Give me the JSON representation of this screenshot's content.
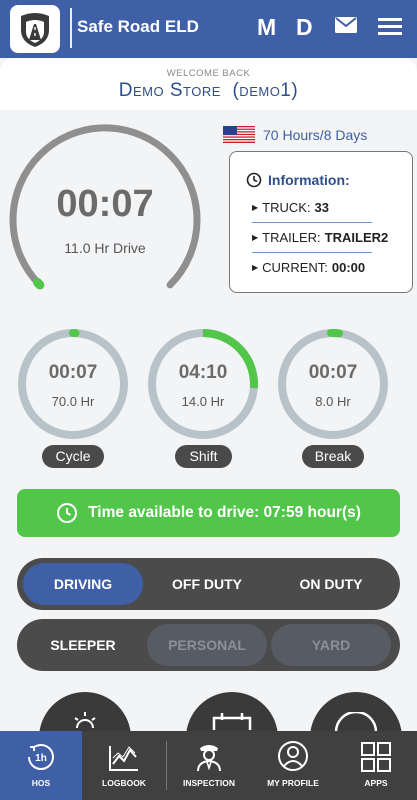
{
  "header": {
    "app_title": "Safe Road ELD",
    "btn_m": "M",
    "btn_d": "D",
    "icons": [
      "shield-road-logo",
      "mail-icon",
      "hamburger-menu-icon"
    ]
  },
  "welcome": {
    "small": "WELCOME BACK",
    "name": "Demo Store  (demo1)"
  },
  "rule": {
    "label": "70 Hours/8 Days"
  },
  "main_gauge": {
    "time": "00:07",
    "label": "11.0 Hr Drive",
    "progress": 0.01
  },
  "info": {
    "title": "Information:",
    "truck_label": "TRUCK:",
    "truck_value": "33",
    "trailer_label": "TRAILER:",
    "trailer_value": "TRAILER2",
    "current_label": "CURRENT:",
    "current_value": "00:00"
  },
  "gauges": [
    {
      "time": "00:07",
      "sub": "70.0 Hr",
      "pill": "Cycle",
      "progress": 0.002
    },
    {
      "time": "04:10",
      "sub": "14.0 Hr",
      "pill": "Shift",
      "progress": 0.3
    },
    {
      "time": "00:07",
      "sub": "8.0 Hr",
      "pill": "Break",
      "progress": 0.015
    }
  ],
  "available": {
    "text": "Time available to drive: 07:59 hour(s)"
  },
  "status_row1": {
    "driving": "DRIVING",
    "off_duty": "OFF DUTY",
    "on_duty": "ON DUTY"
  },
  "status_row2": {
    "sleeper": "SLEEPER",
    "personal": "PERSONAL",
    "yard": "YARD"
  },
  "nav": {
    "hos": "HOS",
    "logbook": "LOGBOOK",
    "inspection": "INSPECTION",
    "profile": "MY PROFILE",
    "apps": "APPS"
  },
  "colors": {
    "primary": "#3f5fa6",
    "green": "#52c64b",
    "gauge_track": "#b8c3c9"
  }
}
